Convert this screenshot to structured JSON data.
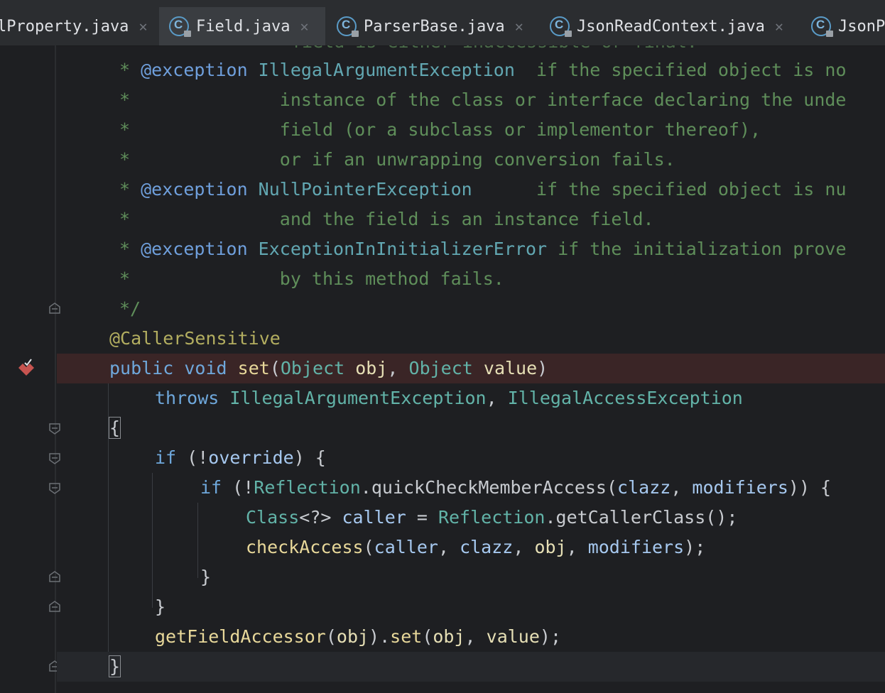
{
  "tabs": [
    {
      "label": "lProperty.java",
      "active": false,
      "icon": "java-class-locked-icon"
    },
    {
      "label": "Field.java",
      "active": true,
      "icon": "java-class-locked-icon"
    },
    {
      "label": "ParserBase.java",
      "active": false,
      "icon": "java-class-locked-icon"
    },
    {
      "label": "JsonReadContext.java",
      "active": false,
      "icon": "java-class-locked-icon"
    },
    {
      "label": "JsonPa",
      "active": false,
      "icon": "java-class-locked-icon"
    }
  ],
  "close_glyph": "✕",
  "breakpoint_icon": "breakpoint-verified-icon",
  "code": {
    "l0": "field is either inaccessible or final.",
    "l1a": "* ",
    "l1b": "@exception",
    "l1c": " IllegalArgumentException",
    "l1d": "  if the specified object is no",
    "l2": "*              instance of the class or interface declaring the unde",
    "l3": "*              field (or a subclass or implementor thereof),",
    "l4": "*              or if an unwrapping conversion fails.",
    "l5a": "* ",
    "l5b": "@exception",
    "l5c": " NullPointerException",
    "l5d": "      if the specified object is nu",
    "l6": "*              and the field is an instance field.",
    "l7a": "* ",
    "l7b": "@exception",
    "l7c": " ExceptionInInitializerError",
    "l7d": " if the initialization prove",
    "l8": "*              by this method fails.",
    "l9": "*/",
    "l10": "@CallerSensitive",
    "l11_kw1": "public",
    "l11_kw2": "void",
    "l11_fn": "set",
    "l11_t1": "Object",
    "l11_p1": "obj",
    "l11_t2": "Object",
    "l11_p2": "value",
    "l12_kw": "throws",
    "l12_t1": "IllegalArgumentException",
    "l12_t2": "IllegalAccessException",
    "l13": "{",
    "l14_kw": "if",
    "l14_field": "override",
    "l15_kw": "if",
    "l15_t": "Reflection",
    "l15_fn": "quickCheckMemberAccess",
    "l15_f1": "clazz",
    "l15_f2": "modifiers",
    "l16_t": "Class",
    "l16_g": "<?>",
    "l16_v": "caller",
    "l16_t2": "Reflection",
    "l16_fn": "getCallerClass",
    "l17_fn": "checkAccess",
    "l17_a1": "caller",
    "l17_a2": "clazz",
    "l17_a3": "obj",
    "l17_a4": "modifiers",
    "l18": "}",
    "l19": "}",
    "l20_fn": "getFieldAccessor",
    "l20_p": "obj",
    "l20_fn2": "set",
    "l20_p2": "obj",
    "l20_p3": "value",
    "l21": "}"
  }
}
